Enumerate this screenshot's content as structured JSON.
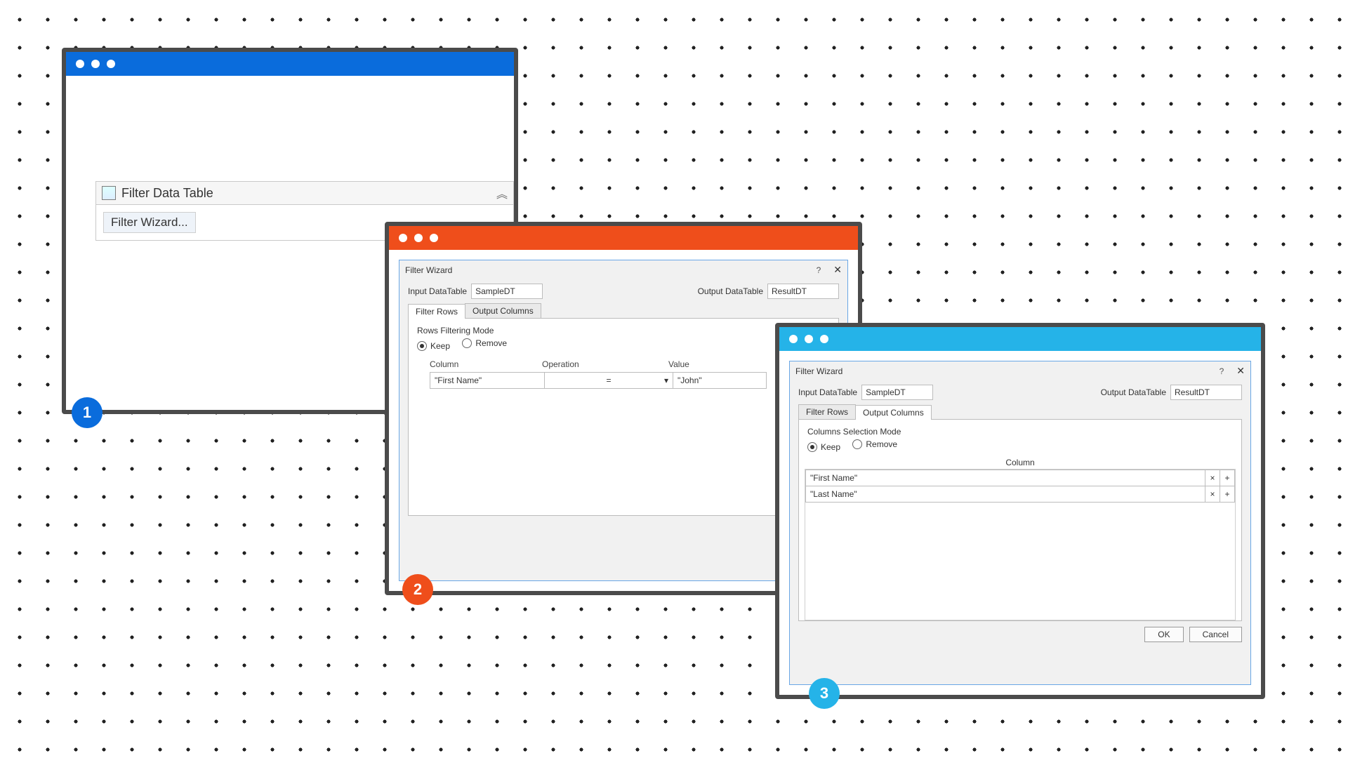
{
  "steps": {
    "s1": "1",
    "s2": "2",
    "s3": "3"
  },
  "colors": {
    "blue": "#0a6cdc",
    "orange": "#ef4e1b",
    "cyan": "#25b3e8"
  },
  "win1": {
    "activity_title": "Filter Data Table",
    "wizard_button": "Filter Wizard..."
  },
  "dialog_common": {
    "title": "Filter Wizard",
    "input_label": "Input DataTable",
    "output_label": "Output DataTable",
    "input_value": "SampleDT",
    "output_value": "ResultDT",
    "tab_rows": "Filter Rows",
    "tab_cols": "Output Columns",
    "keep": "Keep",
    "remove": "Remove",
    "ok": "OK",
    "cancel": "Cancel"
  },
  "win2": {
    "group_title": "Rows Filtering Mode",
    "col_hdr": "Column",
    "op_hdr": "Operation",
    "val_hdr": "Value",
    "column_val": "\"First Name\"",
    "operation_val": "=",
    "value_val": "\"John\""
  },
  "win3": {
    "group_title": "Columns Selection Mode",
    "col_hdr": "Column",
    "rows": [
      "\"First Name\"",
      "\"Last Name\""
    ]
  }
}
